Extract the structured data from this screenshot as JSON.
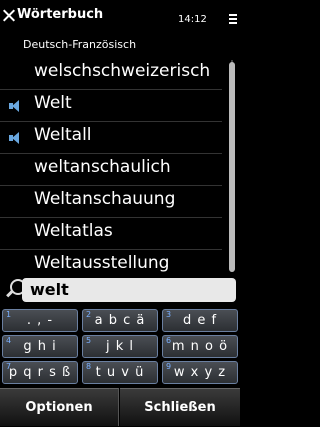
{
  "statusbar": {
    "close_icon": "close-icon",
    "app_title": "Wörterbuch",
    "clock": "14:12",
    "menu_icon": "menu-icon"
  },
  "subtitle": "Deutsch-Französisch",
  "list": {
    "items": [
      {
        "label": "welschschweizerisch",
        "speaker": false
      },
      {
        "label": "Welt",
        "speaker": true
      },
      {
        "label": "Weltall",
        "speaker": true
      },
      {
        "label": "weltanschaulich",
        "speaker": false
      },
      {
        "label": "Weltanschauung",
        "speaker": false
      },
      {
        "label": "Weltatlas",
        "speaker": false
      },
      {
        "label": "Weltausstellung",
        "speaker": false
      }
    ],
    "speaker_icon": "speaker-icon"
  },
  "search": {
    "value": "welt",
    "icon": "search-icon"
  },
  "keypad": {
    "keys": [
      {
        "num": "1",
        "chars": ". , -"
      },
      {
        "num": "2",
        "chars": "a b c ä"
      },
      {
        "num": "3",
        "chars": "d e f"
      },
      {
        "num": "4",
        "chars": "g h i"
      },
      {
        "num": "5",
        "chars": "j k l"
      },
      {
        "num": "6",
        "chars": "m n o ö"
      },
      {
        "num": "7",
        "chars": "p q r s ß"
      },
      {
        "num": "8",
        "chars": "t u v ü"
      },
      {
        "num": "9",
        "chars": "w x y z"
      }
    ]
  },
  "softkeys": {
    "left": "Optionen",
    "right": "Schließen"
  },
  "colors": {
    "background": "#000000",
    "accent": "#6aa8e0",
    "key_number": "#7ab0ff"
  }
}
